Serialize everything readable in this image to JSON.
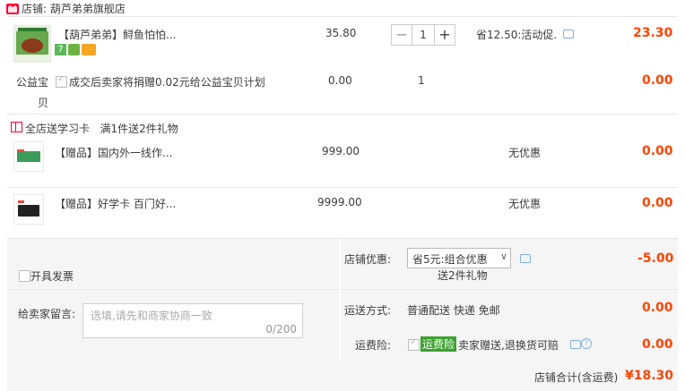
{
  "shop": {
    "label": "店铺: 葫芦弟弟旗舰店"
  },
  "main_item": {
    "title": "【葫芦弟弟】鲟鱼怕怕...",
    "price": "35.80",
    "qty": "1",
    "saving": "省12.50:活动促.",
    "subtotal": "23.30"
  },
  "charity": {
    "label_line1": "公益宝",
    "label_line2": "贝",
    "text": "成交后卖家将捐赠0.02元给公益宝贝计划",
    "price": "0.00",
    "qty": "1",
    "subtotal": "0.00"
  },
  "promo": {
    "text": "全店送学习卡   满1件送2件礼物"
  },
  "gifts": [
    {
      "title": "【赠品】国内外一线作...",
      "price": "999.00",
      "discount": "无优惠",
      "subtotal": "0.00"
    },
    {
      "title": "【赠品】好学卡 百门好...",
      "price": "9999.00",
      "discount": "无优惠",
      "subtotal": "0.00"
    }
  ],
  "invoice": {
    "label": "开具发票"
  },
  "message": {
    "label": "给卖家留言:",
    "placeholder": "选填,请先和商家协商一致",
    "counter": "0/200"
  },
  "discount": {
    "label": "店铺优惠:",
    "selected": "省5元:组合优惠",
    "sub": "送2件礼物",
    "amount": "-5.00"
  },
  "shipping": {
    "label": "运送方式:",
    "value": "普通配送 快递 免邮",
    "amount": "0.00"
  },
  "insurance": {
    "label": "运费险:",
    "badge": "运费险",
    "text": "卖家赠送,退换货可赔",
    "amount": "0.00"
  },
  "total": {
    "label": "店铺合计(含运费)",
    "value": "¥18.30"
  },
  "colors": {
    "accent": "#ff0036",
    "price_red": "#f40",
    "green_badge": "#3aa32f"
  }
}
